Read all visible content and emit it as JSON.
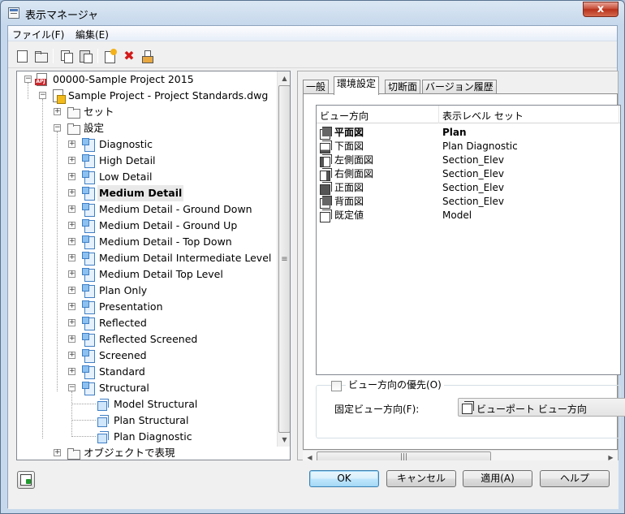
{
  "window": {
    "title": "表示マネージャ",
    "close_symbol": "x"
  },
  "menu": [
    "ファイル(F)",
    "編集(E)"
  ],
  "toolbar": [
    "new-icon",
    "open-icon",
    "copy-icon",
    "paste-icon",
    "new-style-icon",
    "delete-icon",
    "purge-icon"
  ],
  "tree": {
    "project": "00000-Sample Project 2015",
    "drawing": "Sample Project - Project Standards.dwg",
    "sets_folder": "セット",
    "config_folder": "設定",
    "configurations": [
      "Diagnostic",
      "High Detail",
      "Low Detail",
      "Medium Detail",
      "Medium Detail - Ground Down",
      "Medium Detail - Ground Up",
      "Medium Detail - Top Down",
      "Medium Detail Intermediate Level",
      "Medium Detail Top Level",
      "Plan Only",
      "Presentation",
      "Reflected",
      "Reflected Screened",
      "Screened",
      "Standard",
      "Structural"
    ],
    "selected": "Medium Detail",
    "structural_children": [
      "Model Structural",
      "Plan Structural",
      "Plan Diagnostic"
    ],
    "objects_folder": "オブジェクトで表現"
  },
  "tabs": [
    "一般",
    "環境設定",
    "切断面",
    "バージョン履歴"
  ],
  "active_tab": "環境設定",
  "list": {
    "col1": "ビュー方向",
    "col2": "表示レベル セット",
    "rows": [
      {
        "direction": "平面図",
        "set": "Plan",
        "icon": "top-view-icon"
      },
      {
        "direction": "下面図",
        "set": "Plan Diagnostic",
        "icon": "bottom-view-icon"
      },
      {
        "direction": "左側面図",
        "set": "Section_Elev",
        "icon": "left-view-icon"
      },
      {
        "direction": "右側面図",
        "set": "Section_Elev",
        "icon": "right-view-icon"
      },
      {
        "direction": "正面図",
        "set": "Section_Elev",
        "icon": "front-view-icon"
      },
      {
        "direction": "背面図",
        "set": "Section_Elev",
        "icon": "back-view-icon"
      },
      {
        "direction": "既定値",
        "set": "Model",
        "icon": "default-view-icon"
      }
    ]
  },
  "override": {
    "checkbox_label": "ビュー方向の優先(O)",
    "checked": false,
    "fixed_label": "固定ビュー方向(F):",
    "fixed_value": "ビューポート ビュー方向"
  },
  "buttons": {
    "ok": "OK",
    "cancel": "キャンセル",
    "apply": "適用(A)",
    "help": "ヘルプ"
  }
}
